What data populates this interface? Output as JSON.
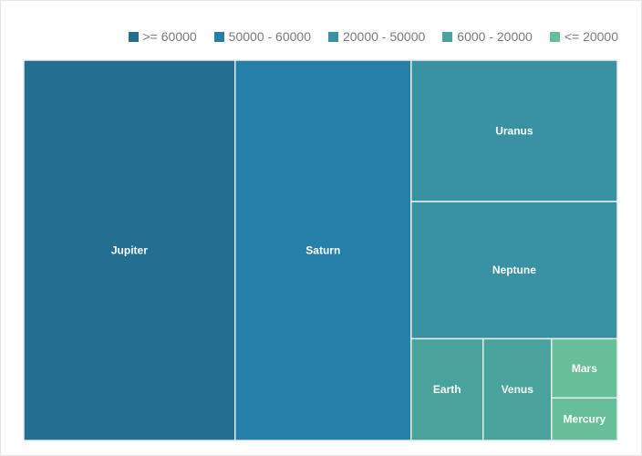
{
  "chart_data": {
    "type": "treemap",
    "title": "",
    "legend": {
      "placement": "top-right",
      "items": [
        {
          "label": ">= 60000",
          "color": "#236f91"
        },
        {
          "label": "50000 - 60000",
          "color": "#267fa8"
        },
        {
          "label": "20000 - 50000",
          "color": "#3892a3"
        },
        {
          "label": "6000 - 20000",
          "color": "#4aa29c"
        },
        {
          "label": "<= 20000",
          "color": "#66bf98"
        }
      ]
    },
    "items": [
      {
        "name": "Jupiter",
        "value": 69911,
        "color": "#236f91"
      },
      {
        "name": "Saturn",
        "value": 58232,
        "color": "#267fa8"
      },
      {
        "name": "Uranus",
        "value": 25362,
        "color": "#3892a3"
      },
      {
        "name": "Neptune",
        "value": 24622,
        "color": "#3892a3"
      },
      {
        "name": "Earth",
        "value": 6371,
        "color": "#4aa29c"
      },
      {
        "name": "Venus",
        "value": 6052,
        "color": "#4aa29c"
      },
      {
        "name": "Mars",
        "value": 3390,
        "color": "#66bf98"
      },
      {
        "name": "Mercury",
        "value": 2440,
        "color": "#66bf98"
      }
    ]
  }
}
